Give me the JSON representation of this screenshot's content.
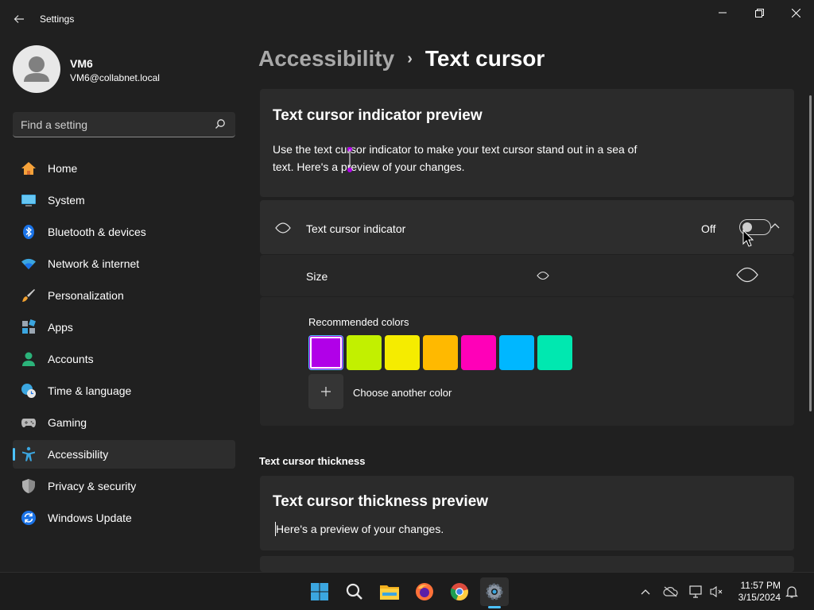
{
  "window": {
    "title": "Settings"
  },
  "user": {
    "name": "VM6",
    "email": "VM6@collabnet.local"
  },
  "search": {
    "placeholder": "Find a setting"
  },
  "sidebar": {
    "items": [
      {
        "label": "Home",
        "icon": "home-icon"
      },
      {
        "label": "System",
        "icon": "system-icon"
      },
      {
        "label": "Bluetooth & devices",
        "icon": "bluetooth-icon"
      },
      {
        "label": "Network & internet",
        "icon": "wifi-icon"
      },
      {
        "label": "Personalization",
        "icon": "brush-icon"
      },
      {
        "label": "Apps",
        "icon": "apps-icon"
      },
      {
        "label": "Accounts",
        "icon": "accounts-icon"
      },
      {
        "label": "Time & language",
        "icon": "globe-clock-icon"
      },
      {
        "label": "Gaming",
        "icon": "gamepad-icon"
      },
      {
        "label": "Accessibility",
        "icon": "accessibility-icon",
        "active": true
      },
      {
        "label": "Privacy & security",
        "icon": "shield-icon"
      },
      {
        "label": "Windows Update",
        "icon": "update-icon"
      }
    ]
  },
  "breadcrumb": {
    "parent": "Accessibility",
    "separator": "›",
    "current": "Text cursor"
  },
  "preview_card": {
    "title": "Text cursor indicator preview",
    "description": "Use the text cursor indicator to make your text cursor stand out in a sea of text. Here's a preview of your changes."
  },
  "indicator": {
    "label": "Text cursor indicator",
    "state_text": "Off",
    "enabled": false
  },
  "size": {
    "label": "Size",
    "value": 0
  },
  "colors": {
    "heading": "Recommended colors",
    "swatches": [
      "#b100e8",
      "#c2f000",
      "#f5ec00",
      "#ffb900",
      "#ff00b8",
      "#00b7ff",
      "#00e8b0"
    ],
    "selected_index": 0,
    "choose_label": "Choose another color"
  },
  "thickness": {
    "heading": "Text cursor thickness",
    "card_title": "Text cursor thickness preview",
    "card_desc": "Here's a preview of your changes."
  },
  "taskbar": {
    "apps": [
      "start-icon",
      "search-icon",
      "file-explorer-icon",
      "firefox-icon",
      "chrome-icon",
      "settings-icon"
    ],
    "time": "11:57 PM",
    "date": "3/15/2024"
  },
  "colors_theme": {
    "accent": "#4cc2ff",
    "background": "#202020",
    "card": "#2b2b2b"
  }
}
